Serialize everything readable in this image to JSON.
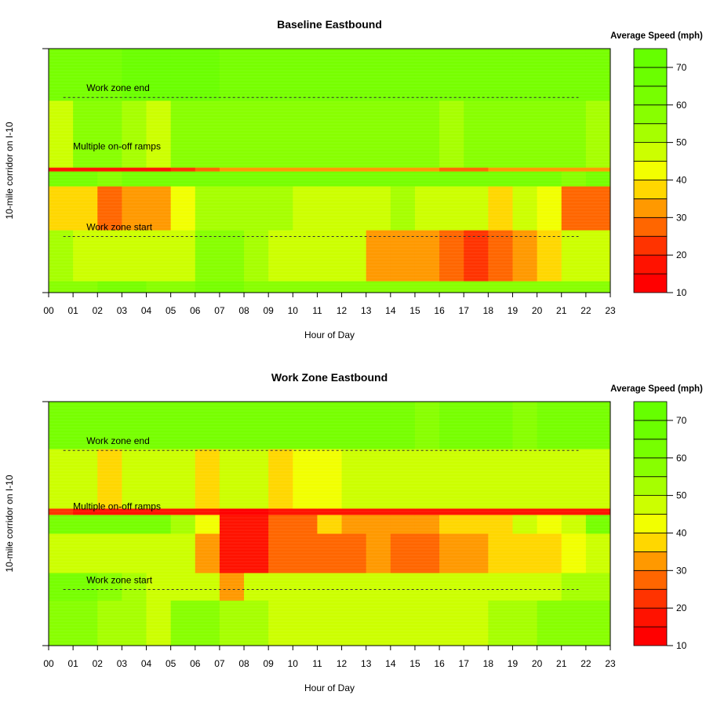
{
  "colorbar": {
    "title": "Average Speed (mph)",
    "breaks": [
      10,
      15,
      20,
      25,
      30,
      35,
      40,
      45,
      50,
      55,
      60,
      65,
      70,
      75
    ],
    "tick_labels": [
      "10",
      "20",
      "30",
      "40",
      "50",
      "60",
      "70"
    ],
    "colors": [
      "#ff0000",
      "#ff1200",
      "#ff3300",
      "#ff6600",
      "#ff9900",
      "#ffd700",
      "#f2ff00",
      "#ccff00",
      "#a6ff00",
      "#88ff00",
      "#77ff00",
      "#6bff00",
      "#66ff00"
    ]
  },
  "chart_data": [
    {
      "type": "heatmap",
      "title": "Baseline Eastbound",
      "xlabel": "Hour of Day",
      "ylabel": "10-mile corridor on I-10",
      "x_tick_labels": [
        "00",
        "01",
        "02",
        "03",
        "04",
        "05",
        "06",
        "07",
        "08",
        "09",
        "10",
        "11",
        "12",
        "13",
        "14",
        "15",
        "16",
        "17",
        "18",
        "19",
        "20",
        "21",
        "22",
        "23"
      ],
      "xlim": [
        0,
        23
      ],
      "ylim": [
        0,
        10
      ],
      "annotations": [
        {
          "text": "Work zone end",
          "mile": 8.0,
          "dashed_line": true
        },
        {
          "text": "Multiple on-off ramps",
          "mile": 6.0,
          "dashed_line": false
        },
        {
          "text": "Work zone start",
          "mile": 2.3,
          "dashed_line": true
        }
      ],
      "rows": [
        {
          "from": 0,
          "to": 0.48,
          "speeds": [
            58,
            58,
            60,
            60,
            58,
            58,
            60,
            60,
            58,
            58,
            58,
            58,
            58,
            58,
            58,
            55,
            55,
            58,
            58,
            58,
            58,
            58,
            58
          ]
        },
        {
          "from": 0.48,
          "to": 2.57,
          "speeds": [
            50,
            47,
            45,
            45,
            45,
            48,
            58,
            55,
            52,
            48,
            48,
            45,
            45,
            32,
            32,
            33,
            25,
            20,
            28,
            33,
            38,
            45,
            48
          ]
        },
        {
          "from": 2.57,
          "to": 4.37,
          "speeds": [
            38,
            37,
            27,
            32,
            32,
            40,
            52,
            52,
            52,
            52,
            48,
            48,
            48,
            45,
            52,
            48,
            48,
            48,
            35,
            45,
            40,
            28,
            28
          ]
        },
        {
          "from": 4.37,
          "to": 4.98,
          "speeds": [
            62,
            62,
            58,
            62,
            62,
            62,
            64,
            64,
            64,
            64,
            62,
            62,
            62,
            62,
            62,
            62,
            62,
            62,
            62,
            62,
            62,
            58,
            62
          ]
        },
        {
          "from": 4.98,
          "to": 5.14,
          "speeds": [
            18,
            18,
            18,
            18,
            18,
            22,
            28,
            30,
            33,
            33,
            33,
            33,
            33,
            33,
            33,
            33,
            28,
            28,
            30,
            30,
            30,
            30,
            30
          ]
        },
        {
          "from": 5.14,
          "to": 7.88,
          "speeds": [
            48,
            55,
            55,
            52,
            45,
            55,
            57,
            57,
            57,
            57,
            55,
            55,
            55,
            57,
            57,
            55,
            52,
            55,
            55,
            55,
            55,
            55,
            52
          ]
        },
        {
          "from": 7.88,
          "to": 10,
          "speeds": [
            64,
            64,
            64,
            66,
            66,
            66,
            66,
            64,
            64,
            64,
            64,
            64,
            64,
            64,
            64,
            64,
            64,
            64,
            64,
            64,
            64,
            64,
            64
          ]
        }
      ]
    },
    {
      "type": "heatmap",
      "title": "Work Zone Eastbound",
      "xlabel": "Hour of Day",
      "ylabel": "10-mile corridor on I-10",
      "x_tick_labels": [
        "00",
        "01",
        "02",
        "03",
        "04",
        "05",
        "06",
        "07",
        "08",
        "09",
        "10",
        "11",
        "12",
        "13",
        "14",
        "15",
        "16",
        "17",
        "18",
        "19",
        "20",
        "21",
        "22",
        "23"
      ],
      "xlim": [
        0,
        23
      ],
      "ylim": [
        0,
        10
      ],
      "annotations": [
        {
          "text": "Work zone end",
          "mile": 8.0,
          "dashed_line": true
        },
        {
          "text": "Multiple on-off ramps",
          "mile": 5.7,
          "dashed_line": false
        },
        {
          "text": "Work zone start",
          "mile": 2.3,
          "dashed_line": true
        }
      ],
      "rows": [
        {
          "from": 0,
          "to": 1.86,
          "speeds": [
            55,
            55,
            50,
            50,
            45,
            55,
            55,
            50,
            50,
            48,
            48,
            48,
            48,
            48,
            45,
            45,
            45,
            45,
            50,
            52,
            55,
            55,
            55
          ]
        },
        {
          "from": 1.86,
          "to": 2.99,
          "speeds": [
            60,
            60,
            55,
            52,
            48,
            48,
            48,
            30,
            45,
            45,
            45,
            45,
            45,
            45,
            45,
            45,
            45,
            48,
            48,
            48,
            48,
            50,
            52
          ]
        },
        {
          "from": 2.99,
          "to": 4.6,
          "speeds": [
            47,
            47,
            45,
            45,
            47,
            45,
            32,
            15,
            15,
            25,
            25,
            25,
            28,
            33,
            28,
            28,
            30,
            33,
            38,
            38,
            38,
            42,
            45
          ]
        },
        {
          "from": 4.6,
          "to": 5.37,
          "speeds": [
            62,
            62,
            62,
            62,
            62,
            50,
            40,
            15,
            18,
            28,
            28,
            35,
            30,
            30,
            32,
            30,
            35,
            38,
            35,
            45,
            40,
            45,
            62
          ]
        },
        {
          "from": 5.37,
          "to": 5.63,
          "speeds": [
            22,
            18,
            18,
            18,
            18,
            18,
            15,
            13,
            13,
            15,
            18,
            18,
            18,
            18,
            18,
            18,
            18,
            18,
            18,
            18,
            18,
            18,
            18
          ]
        },
        {
          "from": 5.63,
          "to": 8.07,
          "speeds": [
            45,
            45,
            38,
            45,
            45,
            45,
            35,
            45,
            45,
            35,
            42,
            42,
            45,
            45,
            45,
            45,
            45,
            45,
            45,
            45,
            45,
            45,
            45
          ]
        },
        {
          "from": 8.07,
          "to": 10,
          "speeds": [
            60,
            60,
            60,
            60,
            60,
            60,
            60,
            60,
            60,
            60,
            60,
            60,
            60,
            60,
            60,
            58,
            60,
            60,
            60,
            58,
            60,
            60,
            60
          ]
        }
      ]
    }
  ]
}
